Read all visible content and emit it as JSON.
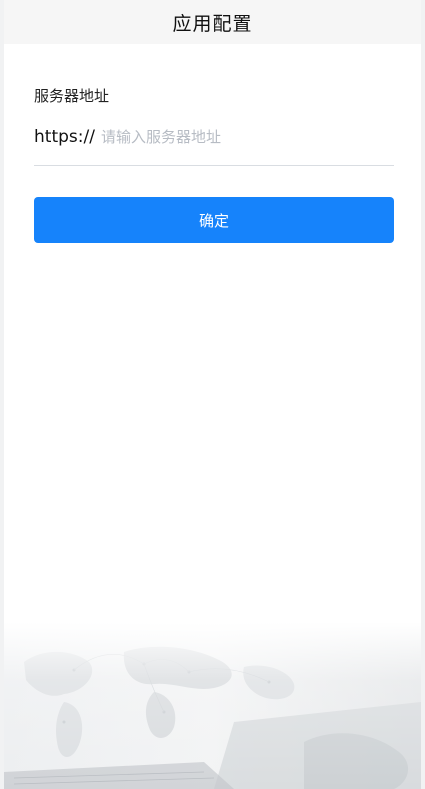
{
  "nav": {
    "title": "应用配置"
  },
  "form": {
    "label": "服务器地址",
    "prefix": "https://",
    "placeholder": "请输入服务器地址",
    "value": ""
  },
  "actions": {
    "confirm_label": "确定"
  },
  "colors": {
    "accent": "#1683fb",
    "nav_background": "#f6f6f6",
    "placeholder": "#b7bcc4"
  },
  "illustration": {
    "description_icon": "world-map-laptop-background"
  }
}
